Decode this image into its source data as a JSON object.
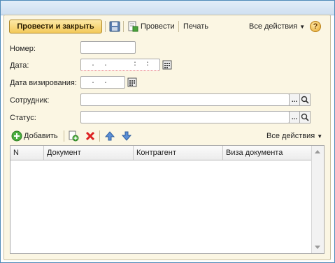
{
  "toolbar": {
    "post_close_label": "Провести и закрыть",
    "save_icon": "floppy-disk-icon",
    "post_label": "Провести",
    "print_label": "Печать",
    "all_actions_label": "Все действия",
    "help_label": "?"
  },
  "fields": {
    "number": {
      "label": "Номер:",
      "value": ""
    },
    "date": {
      "label": "Дата:",
      "value": " .  .      :  :"
    },
    "visa_date": {
      "label": "Дата визирования:",
      "value": " .  ."
    },
    "employee": {
      "label": "Сотрудник:",
      "value": "",
      "pick_label": "..."
    },
    "status": {
      "label": "Статус:",
      "value": "",
      "pick_label": "..."
    }
  },
  "table_toolbar": {
    "add_label": "Добавить",
    "all_actions_label": "Все действия"
  },
  "table": {
    "columns": [
      "N",
      "Документ",
      "Контрагент",
      "Виза документа"
    ],
    "rows": []
  },
  "colors": {
    "accent_button": "#f3c95a",
    "form_background": "#fbf6e3",
    "window_border": "#4f8ab8"
  }
}
